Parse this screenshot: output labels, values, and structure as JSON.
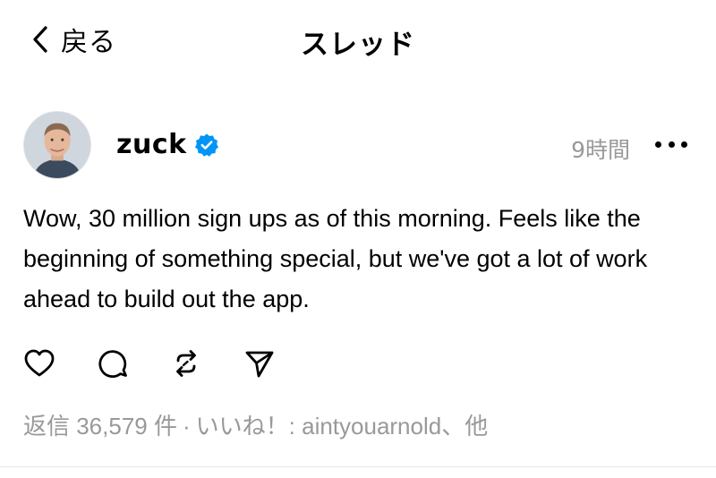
{
  "header": {
    "back_label": "戻る",
    "title": "スレッド"
  },
  "post": {
    "author": "zuck",
    "verified": true,
    "timestamp": "9時間",
    "text": "Wow, 30 million sign ups as of this morning. Feels like the beginning of something special, but we've got a lot of work ahead to build out the app.",
    "replies_label": "返信 36,579 件",
    "separator": "·",
    "likes_label": "いいね！: aintyouarnold、他"
  },
  "icons": {
    "back": "chevron-left-icon",
    "verified": "verified-badge-icon",
    "more": "more-horizontal-icon",
    "like": "heart-icon",
    "reply": "comment-icon",
    "repost": "repost-icon",
    "share": "send-icon"
  },
  "colors": {
    "verified_blue": "#0095f6",
    "muted_text": "#999999"
  }
}
